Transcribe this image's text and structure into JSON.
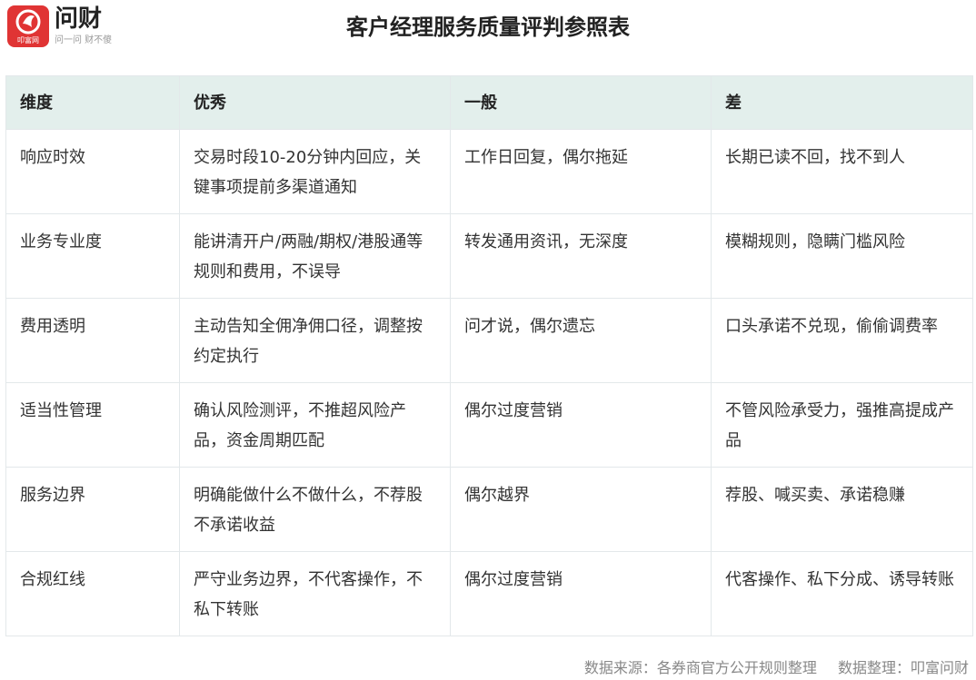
{
  "brand": {
    "name": "问财",
    "slogan": "问一问 财不傻",
    "mark_text": "叩富网",
    "color": "#e03434"
  },
  "title": "客户经理服务质量评判参照表",
  "table": {
    "header_color": "#e3efec",
    "columns": [
      "维度",
      "优秀",
      "一般",
      "差"
    ],
    "rows": [
      {
        "dimension": "响应时效",
        "excellent": "交易时段10-20分钟内回应，关键事项提前多渠道通知",
        "average": "工作日回复，偶尔拖延",
        "poor": "长期已读不回，找不到人"
      },
      {
        "dimension": "业务专业度",
        "excellent": "能讲清开户/两融/期权/港股通等规则和费用，不误导",
        "average": "转发通用资讯，无深度",
        "poor": "模糊规则，隐瞒门槛风险"
      },
      {
        "dimension": "费用透明",
        "excellent": "主动告知全佣净佣口径，调整按约定执行",
        "average": "问才说，偶尔遗忘",
        "poor": "口头承诺不兑现，偷偷调费率"
      },
      {
        "dimension": "适当性管理",
        "excellent": "确认风险测评，不推超风险产品，资金周期匹配",
        "average": "偶尔过度营销",
        "poor": "不管风险承受力，强推高提成产品"
      },
      {
        "dimension": "服务边界",
        "excellent": "明确能做什么不做什么，不荐股不承诺收益",
        "average": "偶尔越界",
        "poor": "荐股、喊买卖、承诺稳赚"
      },
      {
        "dimension": "合规红线",
        "excellent": "严守业务边界，不代客操作，不私下转账",
        "average": "偶尔过度营销",
        "poor": "代客操作、私下分成、诱导转账"
      }
    ]
  },
  "footer": {
    "source": "数据来源：各券商官方公开规则整理",
    "compiled": "数据整理：叩富问财"
  }
}
